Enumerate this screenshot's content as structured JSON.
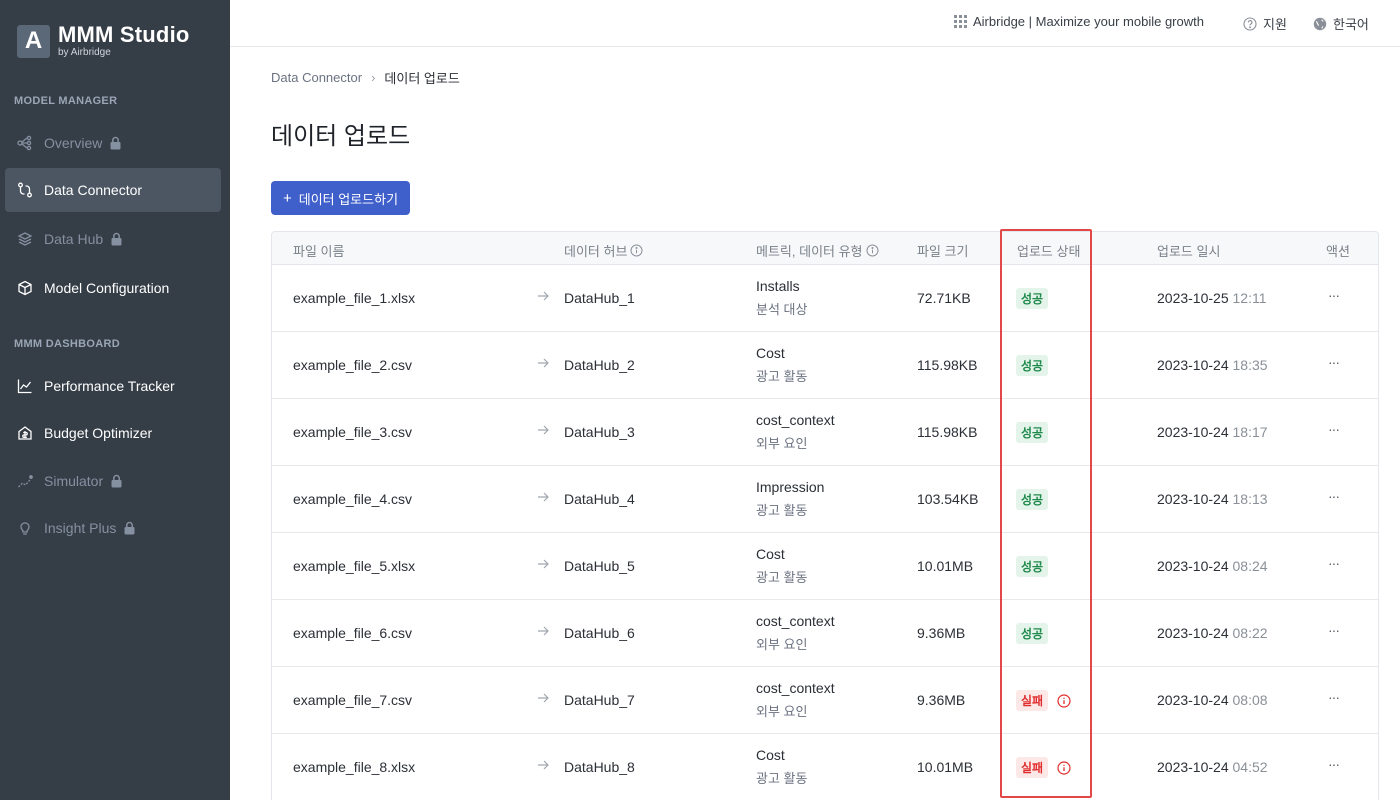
{
  "brand": {
    "title": "MMM Studio",
    "subtitle": "by Airbridge",
    "logo_letter": "A"
  },
  "sidebar": {
    "model_manager_label": "MODEL MANAGER",
    "mmm_dashboard_label": "MMM DASHBOARD",
    "items": [
      {
        "label": "Overview",
        "icon": "overview-icon",
        "locked": true,
        "active": false
      },
      {
        "label": "Data Connector",
        "icon": "data-connector-icon",
        "locked": false,
        "active": true
      },
      {
        "label": "Data Hub",
        "icon": "layers-icon",
        "locked": true,
        "active": false
      },
      {
        "label": "Model Configuration",
        "icon": "cube-icon",
        "locked": false,
        "active": false
      },
      {
        "label": "Performance Tracker",
        "icon": "line-chart-icon",
        "locked": false,
        "active": false
      },
      {
        "label": "Budget Optimizer",
        "icon": "budget-icon",
        "locked": false,
        "active": false
      },
      {
        "label": "Simulator",
        "icon": "scatter-icon",
        "locked": true,
        "active": false
      },
      {
        "label": "Insight Plus",
        "icon": "bulb-icon",
        "locked": true,
        "active": false
      }
    ]
  },
  "topbar": {
    "airbridge": "Airbridge | Maximize your mobile growth",
    "support": "지원",
    "language": "한국어"
  },
  "breadcrumb": {
    "parent": "Data Connector",
    "separator": "›",
    "current": "데이터 업로드"
  },
  "page": {
    "title": "데이터 업로드",
    "upload_button": "데이터 업로드하기"
  },
  "table": {
    "headers": {
      "file_name": "파일 이름",
      "data_hub": "데이터 허브",
      "metric": "메트릭, 데이터 유형",
      "file_size": "파일 크기",
      "status": "업로드 상태",
      "date": "업로드 일시",
      "action": "액션"
    },
    "rows": [
      {
        "file": "example_file_1.xlsx",
        "hub": "DataHub_1",
        "metric": "Installs",
        "type": "분석 대상",
        "size": "72.71KB",
        "status": "성공",
        "status_kind": "ok",
        "date": "2023-10-25",
        "time": "12:11"
      },
      {
        "file": "example_file_2.csv",
        "hub": "DataHub_2",
        "metric": "Cost",
        "type": "광고 활동",
        "size": "115.98KB",
        "status": "성공",
        "status_kind": "ok",
        "date": "2023-10-24",
        "time": "18:35"
      },
      {
        "file": "example_file_3.csv",
        "hub": "DataHub_3",
        "metric": "cost_context",
        "type": "외부 요인",
        "size": "115.98KB",
        "status": "성공",
        "status_kind": "ok",
        "date": "2023-10-24",
        "time": "18:17"
      },
      {
        "file": "example_file_4.csv",
        "hub": "DataHub_4",
        "metric": "Impression",
        "type": "광고 활동",
        "size": "103.54KB",
        "status": "성공",
        "status_kind": "ok",
        "date": "2023-10-24",
        "time": "18:13"
      },
      {
        "file": "example_file_5.xlsx",
        "hub": "DataHub_5",
        "metric": "Cost",
        "type": "광고 활동",
        "size": "10.01MB",
        "status": "성공",
        "status_kind": "ok",
        "date": "2023-10-24",
        "time": "08:24"
      },
      {
        "file": "example_file_6.csv",
        "hub": "DataHub_6",
        "metric": "cost_context",
        "type": "외부 요인",
        "size": "9.36MB",
        "status": "성공",
        "status_kind": "ok",
        "date": "2023-10-24",
        "time": "08:22"
      },
      {
        "file": "example_file_7.csv",
        "hub": "DataHub_7",
        "metric": "cost_context",
        "type": "외부 요인",
        "size": "9.36MB",
        "status": "실패",
        "status_kind": "fail",
        "date": "2023-10-24",
        "time": "08:08"
      },
      {
        "file": "example_file_8.xlsx",
        "hub": "DataHub_8",
        "metric": "Cost",
        "type": "광고 활동",
        "size": "10.01MB",
        "status": "실패",
        "status_kind": "fail",
        "date": "2023-10-24",
        "time": "04:52"
      }
    ],
    "row_action": "···"
  },
  "colors": {
    "sidebar_bg": "#353d47",
    "accent": "#3f5fcb",
    "success": "#1f8a4c",
    "fail": "#e02d2d",
    "highlight": "#e34848"
  }
}
